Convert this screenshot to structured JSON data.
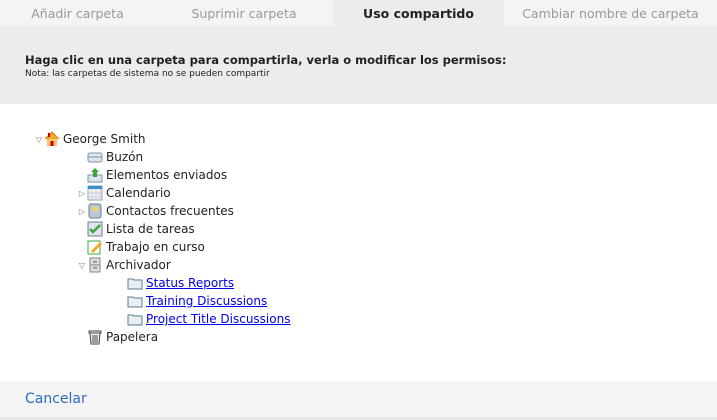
{
  "tabs": [
    {
      "label": "Añadir carpeta"
    },
    {
      "label": "Suprimir carpeta"
    },
    {
      "label": "Uso compartido",
      "active": true
    },
    {
      "label": "Cambiar nombre de carpeta"
    }
  ],
  "header": {
    "title": "Haga clic en una carpeta para compartirla, verla o modificar los permisos:",
    "note": "Nota: las carpetas de sistema no se pueden compartir"
  },
  "tree": {
    "root": "George Smith",
    "items": [
      "Buzón",
      "Elementos enviados",
      "Calendario",
      "Contactos frecuentes",
      "Lista de tareas",
      "Trabajo en curso",
      "Archivador",
      "Papelera"
    ],
    "archive_children": [
      "Status Reports",
      "Training Discussions",
      "Project Title Discussions"
    ]
  },
  "footer": {
    "cancel": "Cancelar"
  },
  "colors": {
    "link": "#0000ee",
    "cancel": "#2a6ebb"
  }
}
